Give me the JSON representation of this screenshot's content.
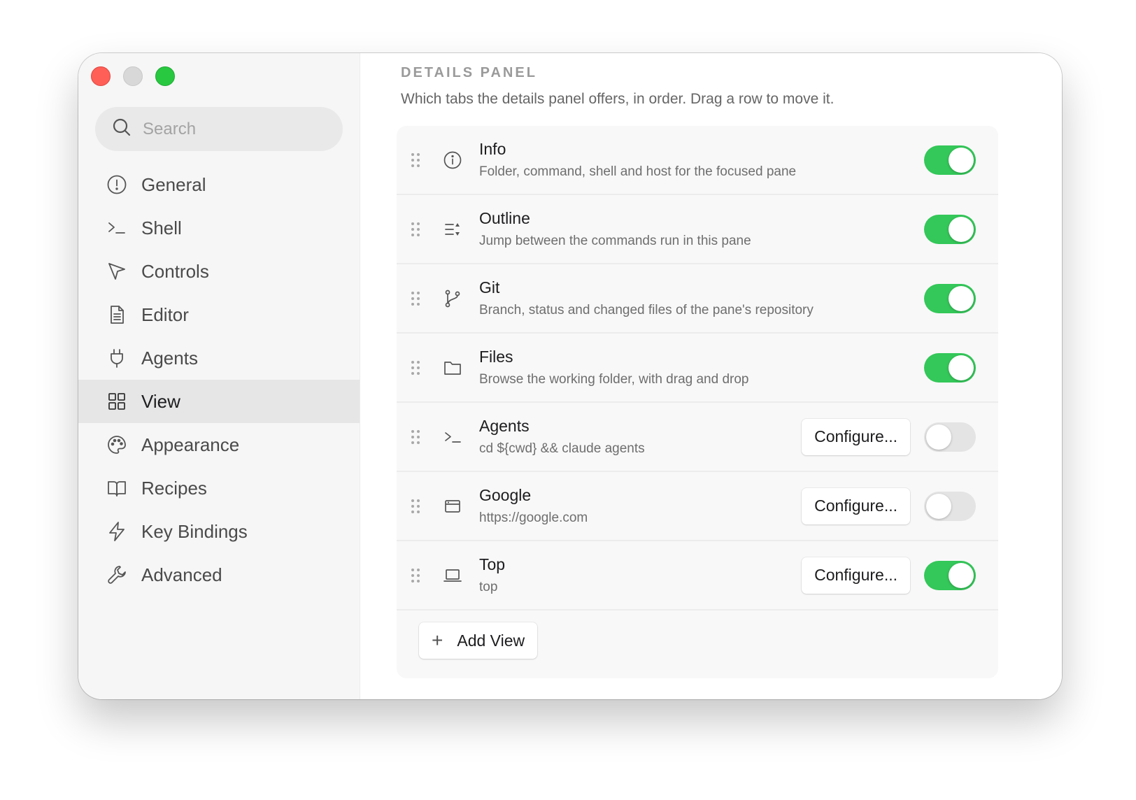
{
  "sidebar": {
    "search_placeholder": "Search",
    "items": [
      {
        "label": "General",
        "icon": "info-circle-icon"
      },
      {
        "label": "Shell",
        "icon": "terminal-prompt-icon"
      },
      {
        "label": "Controls",
        "icon": "cursor-arrow-icon"
      },
      {
        "label": "Editor",
        "icon": "document-icon"
      },
      {
        "label": "Agents",
        "icon": "plug-icon"
      },
      {
        "label": "View",
        "icon": "grid-icon",
        "active": true
      },
      {
        "label": "Appearance",
        "icon": "palette-icon"
      },
      {
        "label": "Recipes",
        "icon": "book-icon"
      },
      {
        "label": "Key Bindings",
        "icon": "lightning-icon"
      },
      {
        "label": "Advanced",
        "icon": "wrench-icon"
      }
    ]
  },
  "main": {
    "section_title": "DETAILS PANEL",
    "section_desc": "Which tabs the details panel offers, in order. Drag a row to move it.",
    "rows": [
      {
        "title": "Info",
        "subtitle": "Folder, command, shell and host for the focused pane",
        "icon": "info-icon",
        "enabled": true,
        "configure": null
      },
      {
        "title": "Outline",
        "subtitle": "Jump between the commands run in this pane",
        "icon": "outline-list-icon",
        "enabled": true,
        "configure": null
      },
      {
        "title": "Git",
        "subtitle": "Branch, status and changed files of the pane's repository",
        "icon": "git-branch-icon",
        "enabled": true,
        "configure": null
      },
      {
        "title": "Files",
        "subtitle": "Browse the working folder, with drag and drop",
        "icon": "folder-icon",
        "enabled": true,
        "configure": null
      },
      {
        "title": "Agents",
        "subtitle": "cd ${cwd} && claude agents",
        "icon": "terminal-prompt-icon",
        "enabled": false,
        "configure": "Configure..."
      },
      {
        "title": "Google",
        "subtitle": "https://google.com",
        "icon": "browser-window-icon",
        "enabled": false,
        "configure": "Configure..."
      },
      {
        "title": "Top",
        "subtitle": "top",
        "icon": "laptop-icon",
        "enabled": true,
        "configure": "Configure..."
      }
    ],
    "add_view_label": "Add View"
  },
  "colors": {
    "toggle_on": "#34c759",
    "toggle_off": "#e4e4e4",
    "traffic_close": "#ff5f57",
    "traffic_min": "#d8d8d8",
    "traffic_max": "#28c840"
  }
}
